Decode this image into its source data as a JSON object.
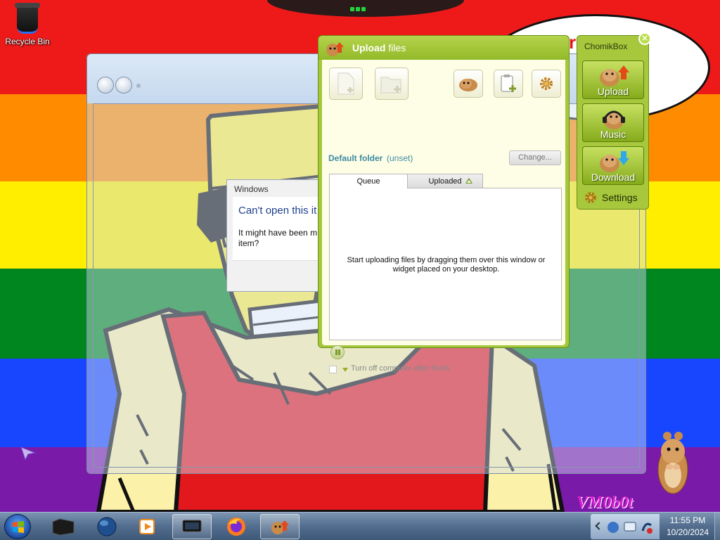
{
  "desktop": {
    "recycle_bin_label": "Recycle Bin",
    "speech_text": "r    nth",
    "watermark": "VM0b0t"
  },
  "error_dialog": {
    "title": "Windows",
    "heading": "Can't open this it",
    "message": "It might have been m to remove this item?"
  },
  "upload_window": {
    "title_bold": "Upload",
    "title_rest": "files",
    "default_folder_label": "Default folder",
    "default_folder_value": "(unset)",
    "change_button": "Change...",
    "tabs": {
      "queue": "Queue",
      "uploaded": "Uploaded"
    },
    "queue_empty_message": "Start uploading files by dragging them over this window or widget placed on your desktop.",
    "shutdown_label": "Turn off computer after finish",
    "shutdown_checked": false
  },
  "chomik_panel": {
    "title": "ChomikBox",
    "buttons": {
      "upload": "Upload",
      "music": "Music",
      "download": "Download"
    },
    "settings_label": "Settings"
  },
  "taskbar": {
    "clock_time": "11:55 PM",
    "clock_date": "10/20/2024",
    "accent_color": "#526d8e"
  },
  "colors": {
    "chomik_green": "#a5c73c",
    "panel_cream": "#fefee6",
    "folder_text": "#3d8aa3"
  }
}
